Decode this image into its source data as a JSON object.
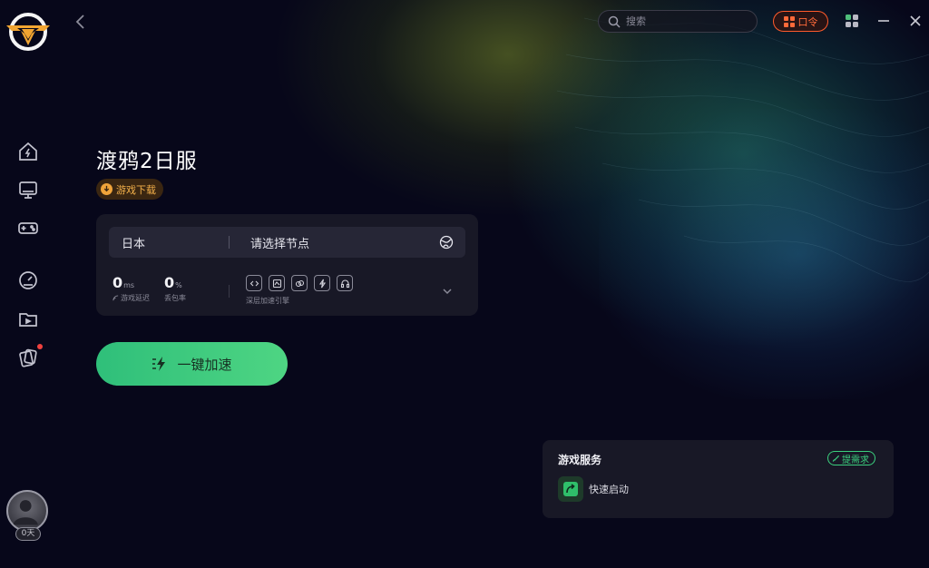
{
  "app": {
    "name": "game accelerator"
  },
  "header": {
    "search_placeholder": "搜索",
    "kouling_label": "口令",
    "icons": [
      "back-icon",
      "search-icon",
      "apps-grid-icon",
      "minimize-icon",
      "close-icon"
    ]
  },
  "sidebar": {
    "items": [
      {
        "name": "home",
        "icon": "home-bolt-icon"
      },
      {
        "name": "monitor",
        "icon": "monitor-icon"
      },
      {
        "name": "gamepad",
        "icon": "gamepad-icon"
      },
      {
        "name": "speedometer",
        "icon": "speedometer-icon"
      },
      {
        "name": "folder",
        "icon": "folder-icon"
      },
      {
        "name": "cards",
        "icon": "cards-icon",
        "badge": true
      }
    ],
    "user": {
      "days_label": "0天"
    }
  },
  "game": {
    "title": "渡鸦2日服",
    "download_label": "游戏下载"
  },
  "panel": {
    "region": "日本",
    "node_placeholder": "请选择节点",
    "latency_value": "0",
    "latency_unit": "ms",
    "latency_label": "游戏延迟",
    "loss_value": "0",
    "loss_unit": "%",
    "loss_label": "丢包率",
    "engine_label": "深层加速引擎"
  },
  "accelerate": {
    "label": "一键加速"
  },
  "service": {
    "title": "游戏服务",
    "request_label": "提需求",
    "items": [
      {
        "label": "快速启动",
        "icon": "quick-launch-icon"
      }
    ]
  },
  "colors": {
    "accent_green": "#3fcf7f",
    "accent_orange": "#ff5a2b",
    "download_gold": "#f3b04a",
    "background": "#07071a"
  }
}
